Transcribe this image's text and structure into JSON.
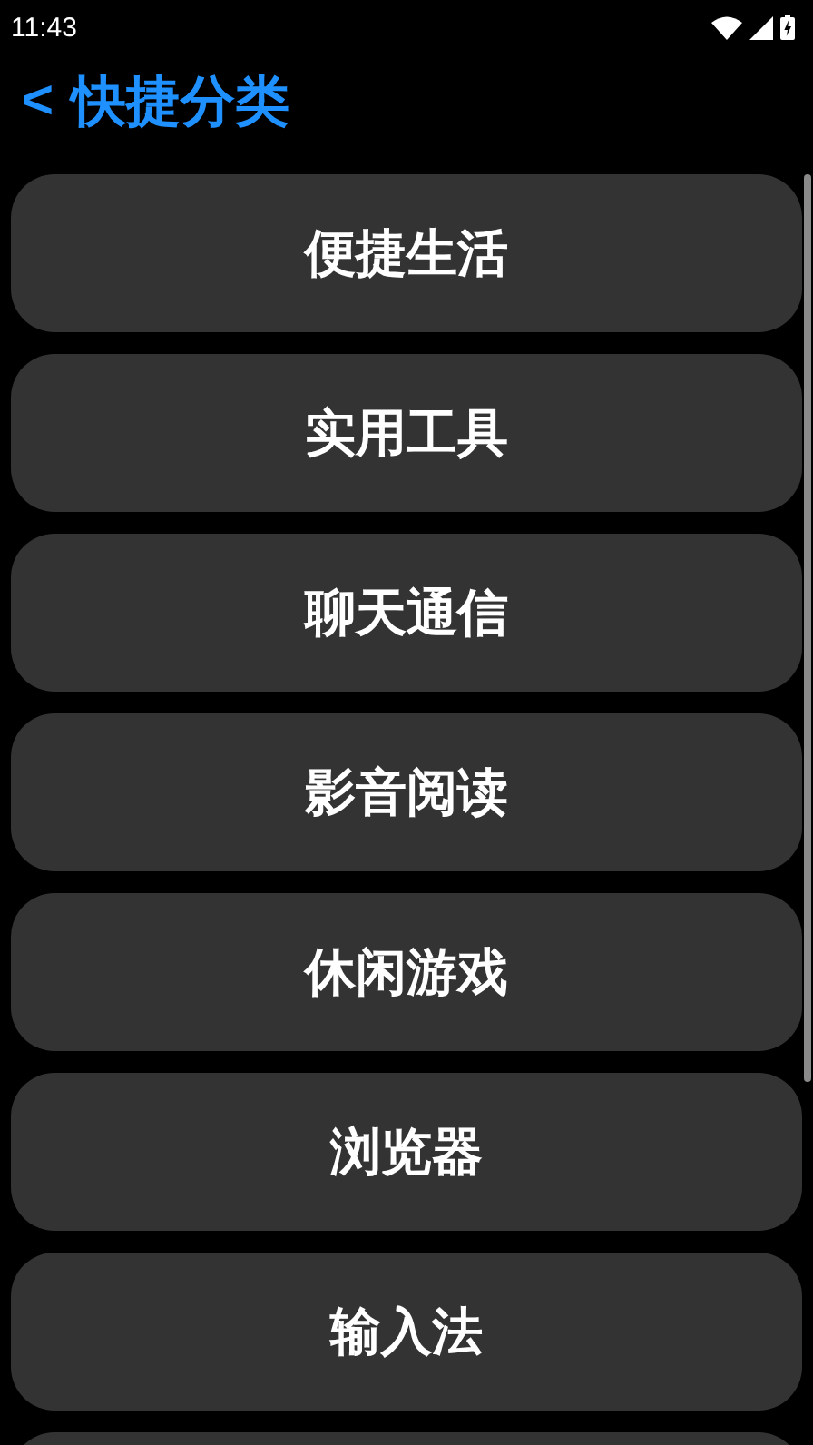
{
  "status_bar": {
    "time": "11:43"
  },
  "header": {
    "back": "<",
    "title": "快捷分类"
  },
  "categories": [
    {
      "label": "便捷生活"
    },
    {
      "label": "实用工具"
    },
    {
      "label": "聊天通信"
    },
    {
      "label": "影音阅读"
    },
    {
      "label": "休闲游戏"
    },
    {
      "label": "浏览器"
    },
    {
      "label": "输入法"
    }
  ]
}
